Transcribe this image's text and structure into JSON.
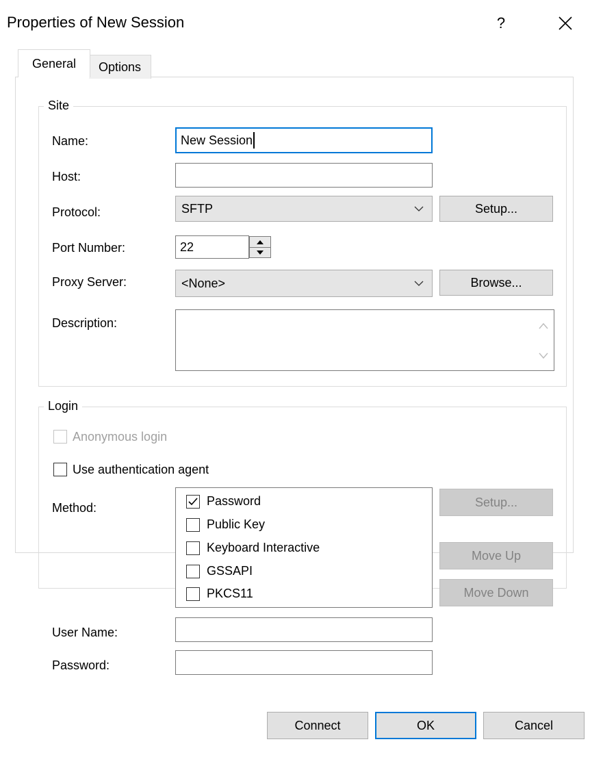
{
  "window": {
    "title": "Properties of New Session",
    "help_glyph": "?"
  },
  "tabs": [
    {
      "label": "General"
    },
    {
      "label": "Options"
    }
  ],
  "site": {
    "legend": "Site",
    "name_label": "Name:",
    "name_value": "New Session",
    "host_label": "Host:",
    "host_value": "",
    "protocol_label": "Protocol:",
    "protocol_value": "SFTP",
    "protocol_setup_button": "Setup...",
    "port_label": "Port Number:",
    "port_value": "22",
    "proxy_label": "Proxy Server:",
    "proxy_value": "<None>",
    "proxy_browse_button": "Browse...",
    "description_label": "Description:",
    "description_value": ""
  },
  "login": {
    "legend": "Login",
    "anonymous_label": "Anonymous login",
    "anonymous_checked": false,
    "auth_agent_label": "Use authentication agent",
    "auth_agent_checked": false,
    "method_label": "Method:",
    "methods": [
      {
        "label": "Password",
        "checked": true
      },
      {
        "label": "Public Key",
        "checked": false
      },
      {
        "label": "Keyboard Interactive",
        "checked": false
      },
      {
        "label": "GSSAPI",
        "checked": false
      },
      {
        "label": "PKCS11",
        "checked": false
      }
    ],
    "method_setup_button": "Setup...",
    "move_up_button": "Move Up",
    "move_down_button": "Move Down",
    "username_label": "User Name:",
    "username_value": "",
    "password_label": "Password:",
    "password_value": ""
  },
  "footer": {
    "connect_button": "Connect",
    "ok_button": "OK",
    "cancel_button": "Cancel"
  },
  "colors": {
    "focus_accent": "#0078d7",
    "disabled_button": "#cccccc",
    "button_face": "#e1e1e1"
  }
}
